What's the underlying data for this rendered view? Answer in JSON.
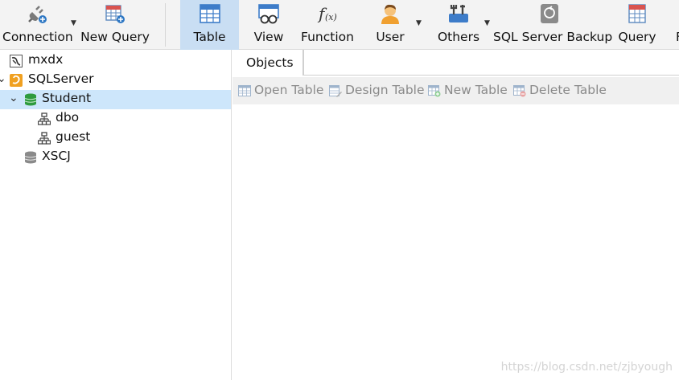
{
  "toolbar": {
    "connection": "Connection",
    "new_query": "New Query",
    "table": "Table",
    "view": "View",
    "function": "Function",
    "user": "User",
    "others": "Others",
    "backup": "SQL Server Backup",
    "query": "Query",
    "cut_off": "F"
  },
  "tree": {
    "items": [
      {
        "label": "mxdx",
        "icon": "connection-icon"
      },
      {
        "label": "SQLServer",
        "icon": "sqlserver-icon"
      },
      {
        "label": "Student",
        "icon": "database-icon"
      },
      {
        "label": "dbo",
        "icon": "schema-icon"
      },
      {
        "label": "guest",
        "icon": "schema-icon"
      },
      {
        "label": "XSCJ",
        "icon": "database-icon"
      }
    ]
  },
  "tabs": {
    "objects": "Objects"
  },
  "object_toolbar": {
    "open_table": "Open Table",
    "design_table": "Design Table",
    "new_table": "New Table",
    "delete_table": "Delete Table"
  },
  "watermark": "https://blog.csdn.net/zjbyough",
  "colors": {
    "active_toolbar": "#c9def3",
    "selected_row": "#cde6fb",
    "database_green": "#2e9b3e"
  }
}
